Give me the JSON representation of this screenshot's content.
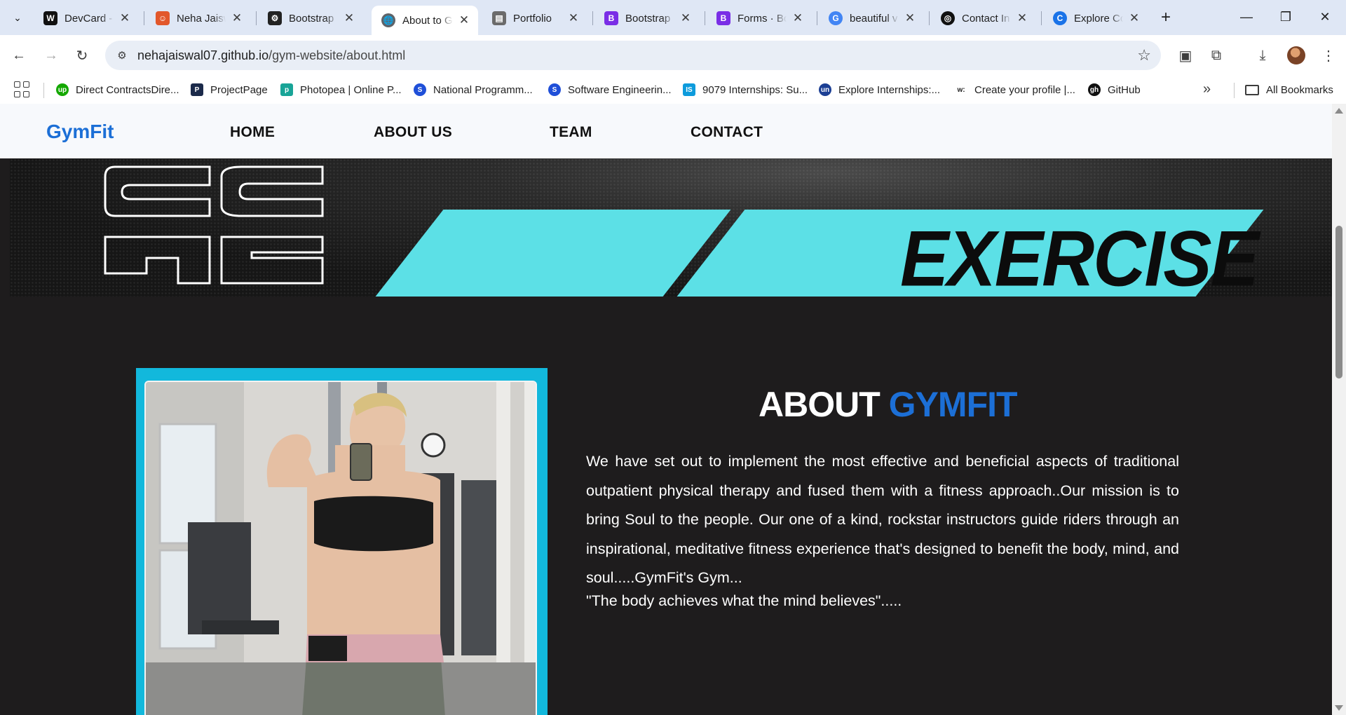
{
  "browser": {
    "tabs": [
      {
        "label": "DevCard -",
        "favicon": "W",
        "favicon_bg": "#111111",
        "active": false
      },
      {
        "label": "Neha Jaisw",
        "favicon": "☺",
        "favicon_bg": "#e2572b",
        "active": false
      },
      {
        "label": "Bootstrap",
        "favicon": "⚙",
        "favicon_bg": "#222222",
        "active": false
      },
      {
        "label": "About to G",
        "favicon": "🌐",
        "favicon_bg": "#5f6368",
        "active": true
      },
      {
        "label": "Portfolio",
        "favicon": "▤",
        "favicon_bg": "#6b6b6b",
        "active": false
      },
      {
        "label": "Bootstrap",
        "favicon": "B",
        "favicon_bg": "#7a2ee6",
        "active": false
      },
      {
        "label": "Forms · Bo",
        "favicon": "B",
        "favicon_bg": "#7a2ee6",
        "active": false
      },
      {
        "label": "beautiful v",
        "favicon": "G",
        "favicon_bg": "#4285f4",
        "active": false
      },
      {
        "label": "Contact In",
        "favicon": "◎",
        "favicon_bg": "#111111",
        "active": false
      },
      {
        "label": "Explore Co",
        "favicon": "C",
        "favicon_bg": "#1a73e8",
        "active": false
      }
    ],
    "url_host": "nehajaiswal07.github.io",
    "url_path": "/gym-website/about.html",
    "bookmarks": [
      {
        "label": "Direct ContractsDire...",
        "icon": "up",
        "color": "#14a800"
      },
      {
        "label": "ProjectPage",
        "icon": "P",
        "color": "#1b2a4a"
      },
      {
        "label": "Photopea | Online P...",
        "icon": "p",
        "color": "#18a497"
      },
      {
        "label": "National Programm...",
        "icon": "S",
        "color": "#1f4fd8"
      },
      {
        "label": "Software Engineerin...",
        "icon": "S",
        "color": "#1f4fd8"
      },
      {
        "label": "9079 Internships: Su...",
        "icon": "IS",
        "color": "#0d9bdc"
      },
      {
        "label": "Explore Internships:...",
        "icon": "un",
        "color": "#1c3f94"
      },
      {
        "label": "Create your profile |...",
        "icon": "w:",
        "color": "#ffffff"
      },
      {
        "label": "GitHub",
        "icon": "gh",
        "color": "#111111"
      }
    ],
    "all_bookmarks": "All Bookmarks"
  },
  "site": {
    "brand": "GymFit",
    "nav": {
      "home": "HOME",
      "about": "ABOUT US",
      "team": "TEAM",
      "contact": "CONTACT"
    },
    "banner_word": "EXERCISE",
    "about_title_prefix": "ABOUT",
    "about_title_accent": "GYMFIT",
    "about_paragraph": "We have set out to implement the most effective and beneficial aspects of traditional outpatient physical therapy and fused them with a fitness approach..Our mission is to bring Soul to the people. Our one of a kind, rockstar instructors guide riders through an inspirational, meditative fitness experience that's designed to benefit the body, mind, and soul.....GymFit's Gym...",
    "quote": "\"The body achieves what the mind believes\".....",
    "colors": {
      "brand": "#1c6fd6",
      "frame": "#12b8dc",
      "stripe": "#5ce0e6",
      "page_bg": "#1e1c1d"
    }
  }
}
